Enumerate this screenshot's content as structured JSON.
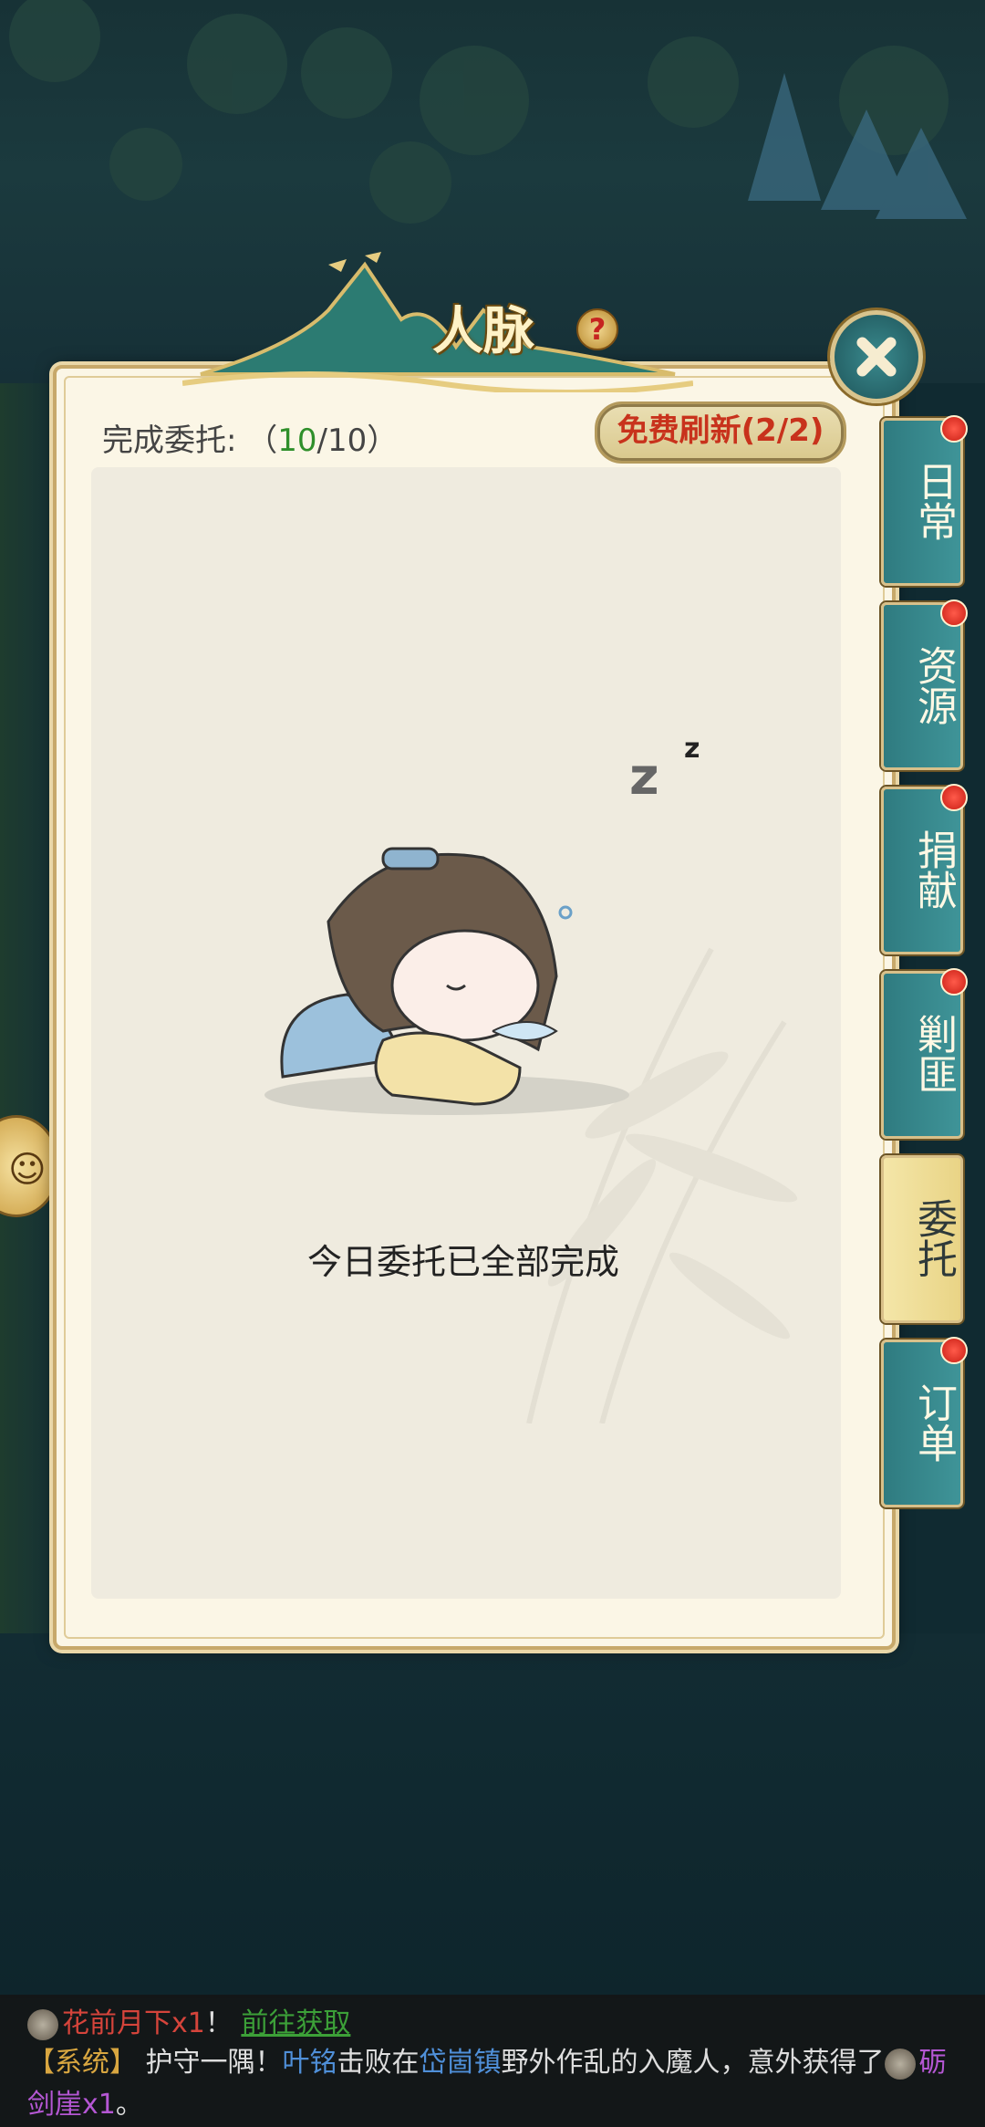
{
  "dialog": {
    "title": "人脉",
    "help_icon": "question-icon",
    "close_icon": "close-icon",
    "progress_prefix": "完成委托:",
    "progress_open": "（",
    "progress_done": "10",
    "progress_sep": "/",
    "progress_total": "10",
    "progress_close": "）",
    "refresh_label": "免费刷新(2/2)",
    "done_message": "今日委托已全部完成"
  },
  "tabs": [
    {
      "label": "日常",
      "badge": true,
      "active": false
    },
    {
      "label": "资源",
      "badge": true,
      "active": false
    },
    {
      "label": "捐献",
      "badge": true,
      "active": false
    },
    {
      "label": "剿匪",
      "badge": true,
      "active": false
    },
    {
      "label": "委托",
      "badge": false,
      "active": true
    },
    {
      "label": "订单",
      "badge": true,
      "active": false
    }
  ],
  "chat": {
    "line1_item": "花前月下x1",
    "line1_mark": "！",
    "line1_link": "前往获取",
    "line2_tag": "【系统】",
    "line2_a": "护守一隅！",
    "line2_name": "叶铭",
    "line2_b": "击败在",
    "line2_place": "岱崮镇",
    "line2_c": "野外作乱的入魔人，意外获得了",
    "line2_item": "砺剑崖x1",
    "line2_end": "。"
  },
  "colors": {
    "accent_teal": "#3f9498",
    "refresh_text": "#c8321c",
    "progress_done": "#2f8f2a",
    "badge_red": "#d42a1e"
  }
}
